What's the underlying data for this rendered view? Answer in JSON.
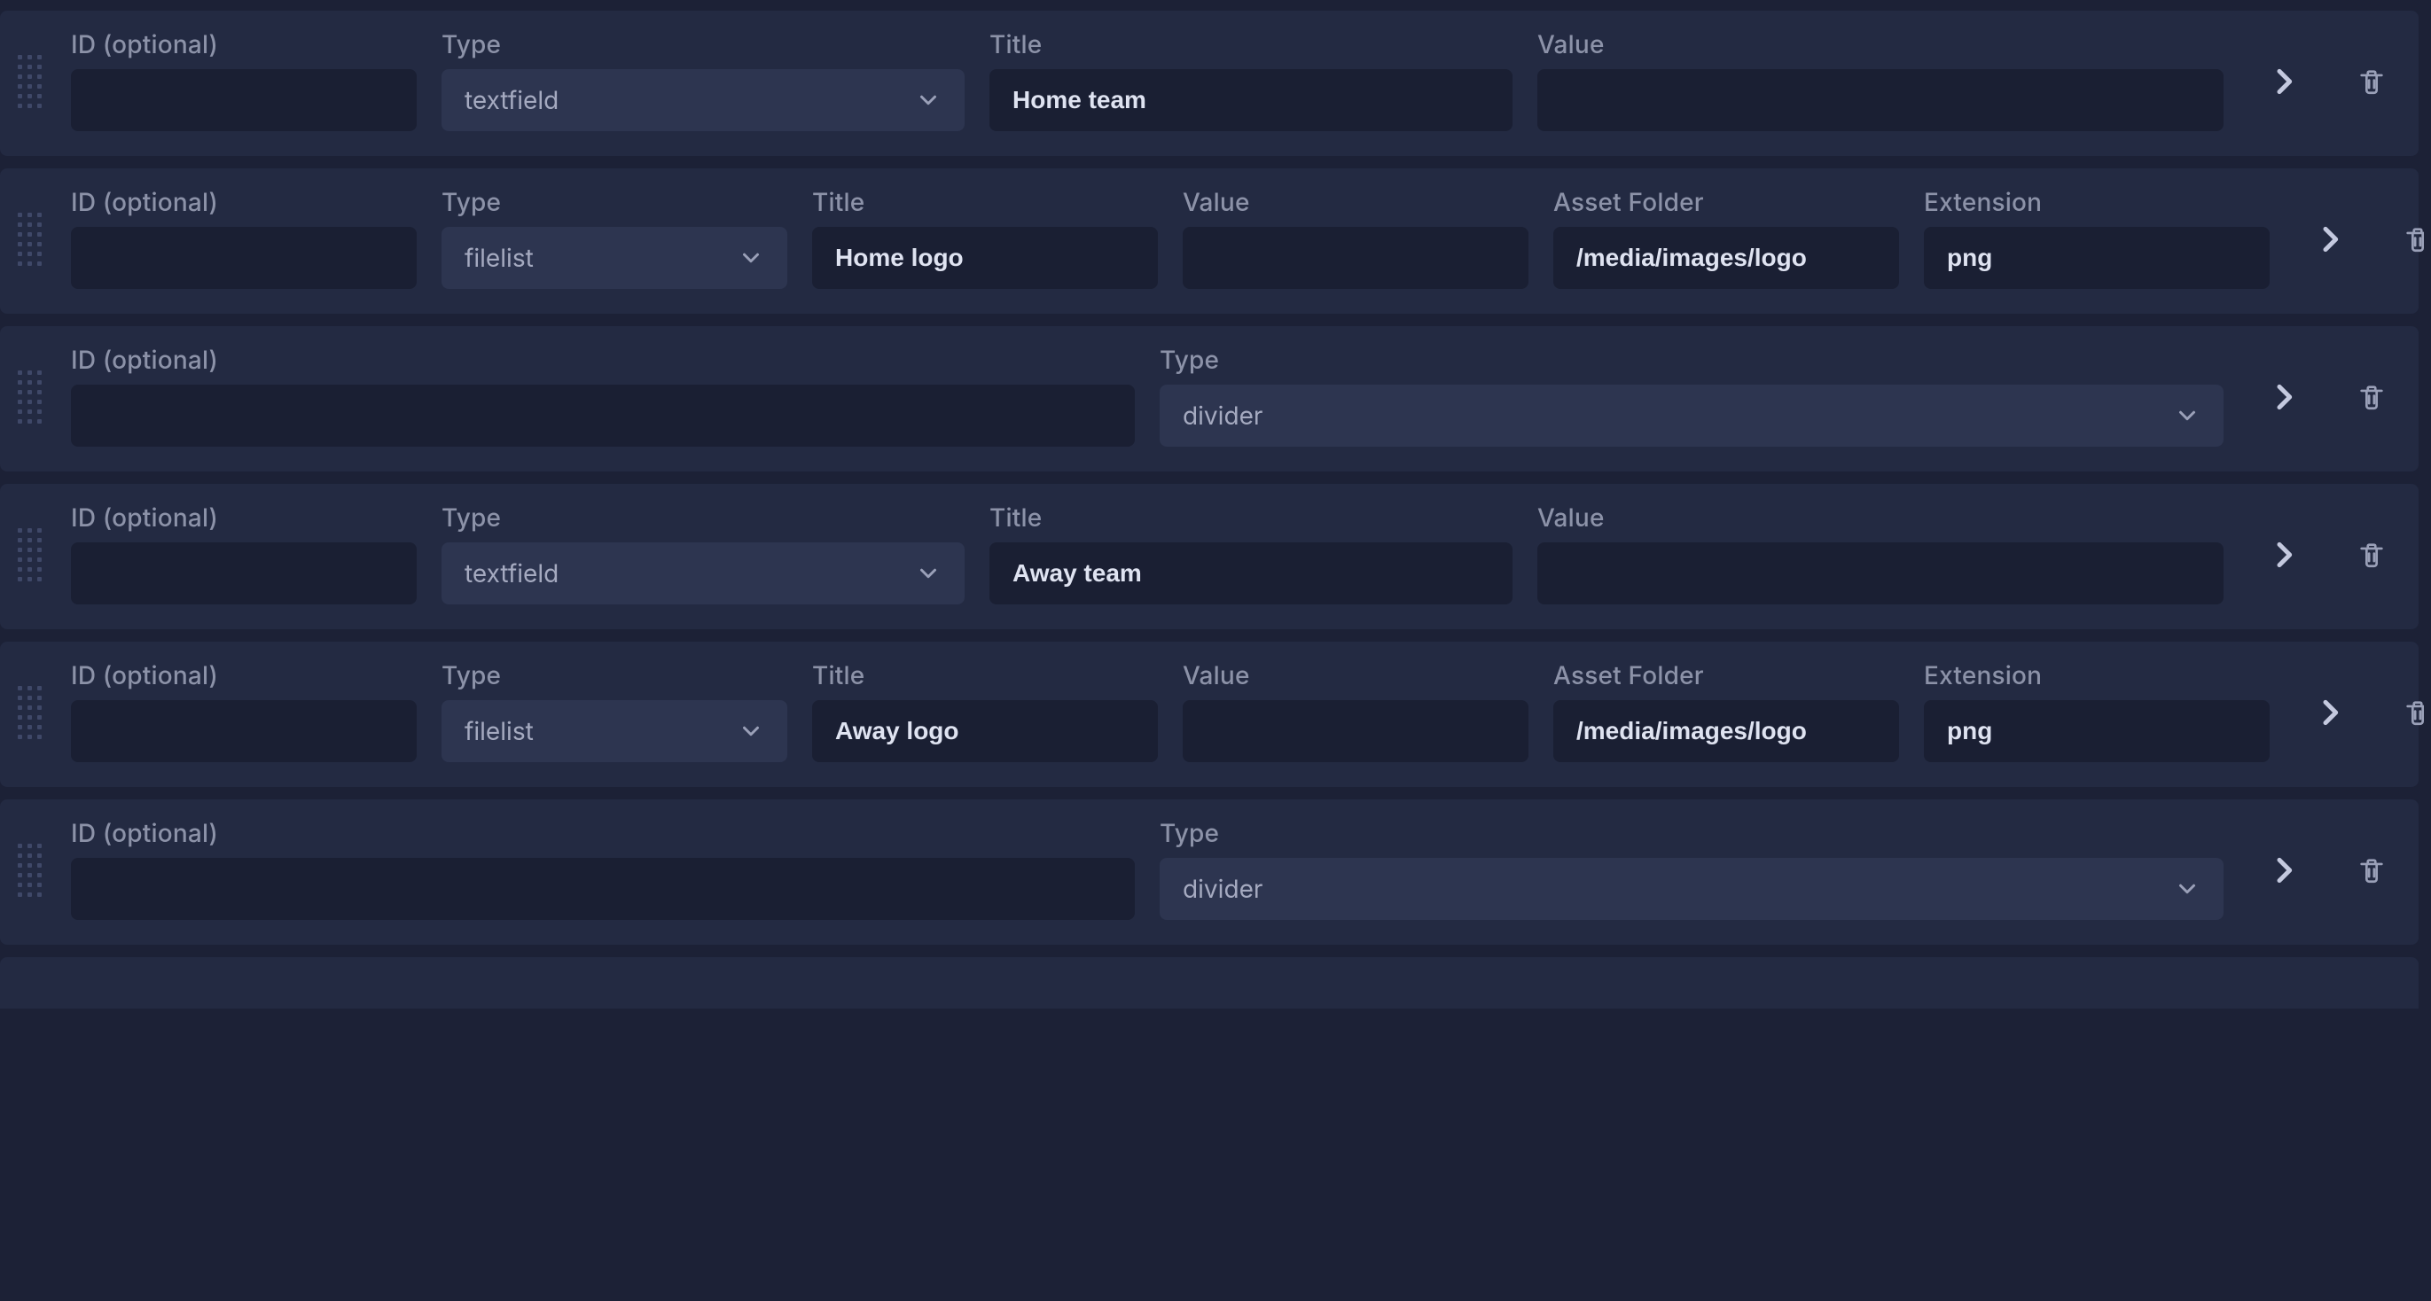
{
  "labels": {
    "id": "ID (optional)",
    "type": "Type",
    "title": "Title",
    "value": "Value",
    "asset_folder": "Asset Folder",
    "extension": "Extension"
  },
  "rows": [
    {
      "kind": "textfield",
      "id": "",
      "type": "textfield",
      "title": "Home team",
      "value": ""
    },
    {
      "kind": "filelist",
      "id": "",
      "type": "filelist",
      "title": "Home logo",
      "value": "",
      "asset_folder": "/media/images/logo",
      "extension": "png"
    },
    {
      "kind": "divider",
      "id": "",
      "type": "divider"
    },
    {
      "kind": "textfield",
      "id": "",
      "type": "textfield",
      "title": "Away team",
      "value": ""
    },
    {
      "kind": "filelist",
      "id": "",
      "type": "filelist",
      "title": "Away logo",
      "value": "",
      "asset_folder": "/media/images/logo",
      "extension": "png"
    },
    {
      "kind": "divider",
      "id": "",
      "type": "divider"
    }
  ]
}
